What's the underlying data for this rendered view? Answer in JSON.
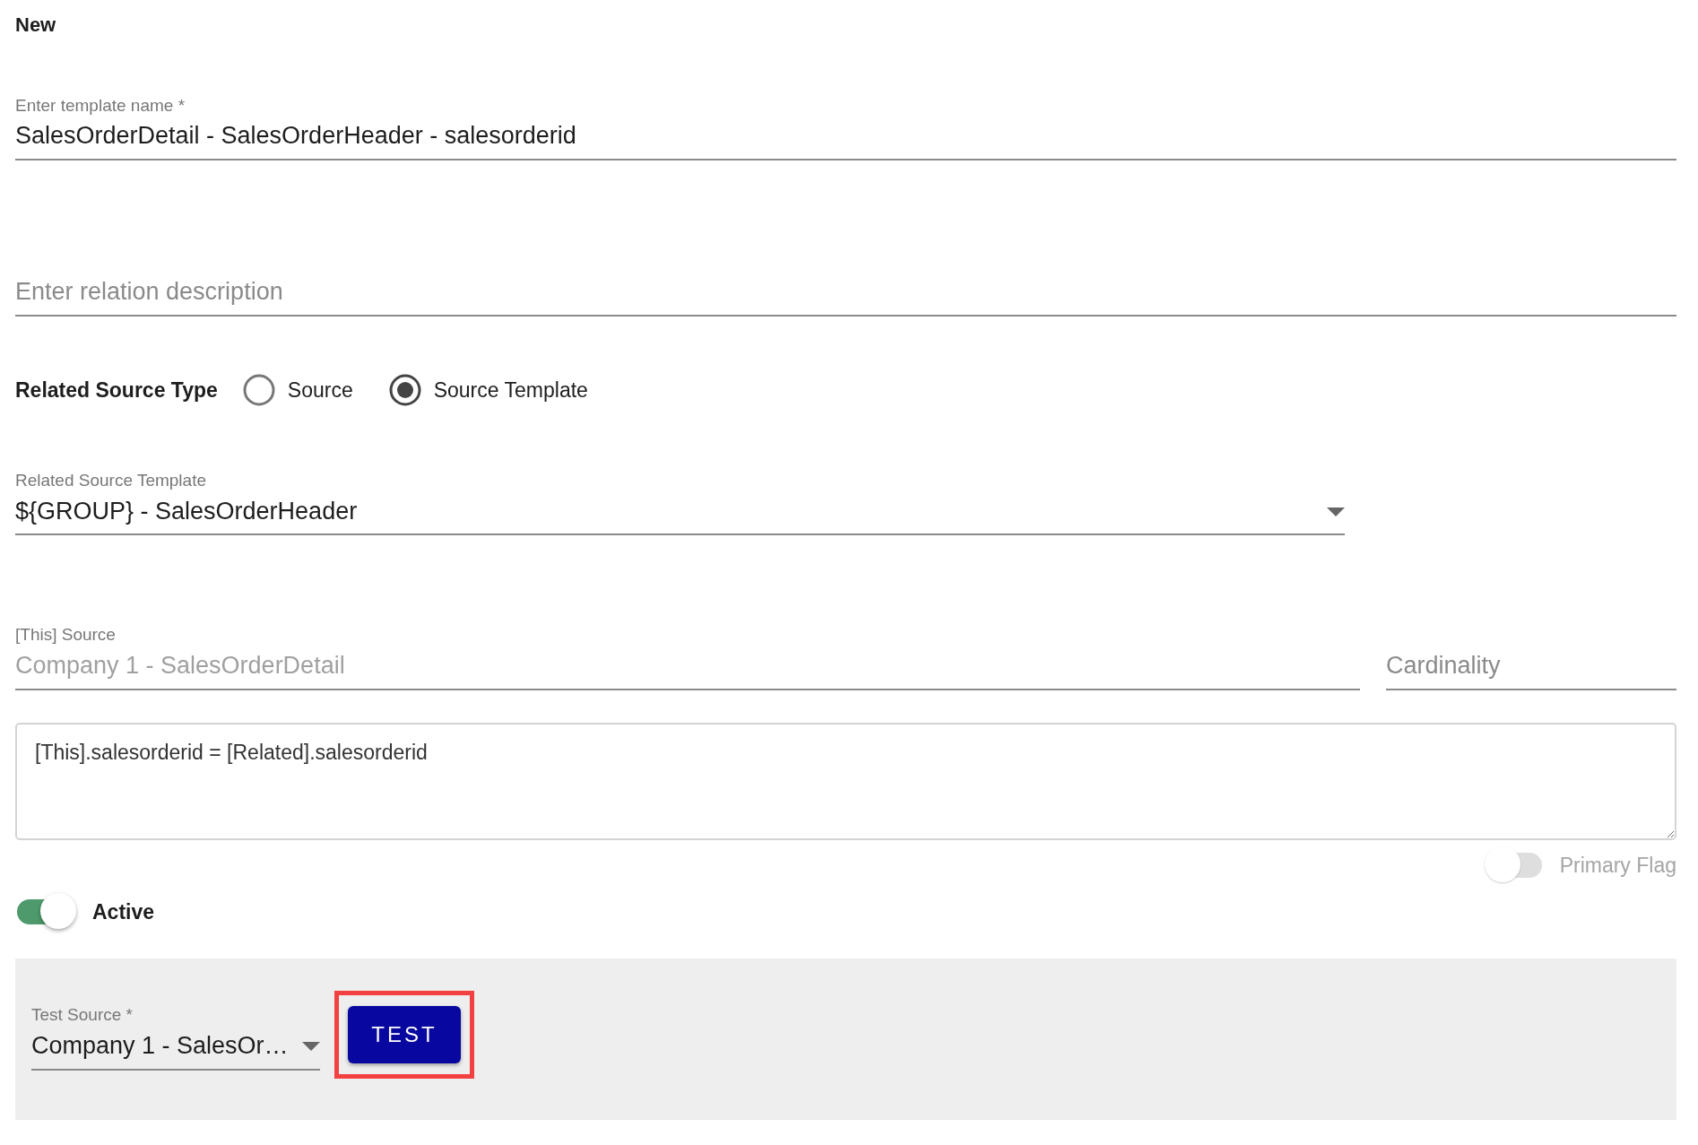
{
  "title": "New",
  "template_name": {
    "label": "Enter template name *",
    "value": "SalesOrderDetail - SalesOrderHeader - salesorderid"
  },
  "description": {
    "placeholder": "Enter relation description"
  },
  "related_source_type": {
    "label": "Related Source Type",
    "options": [
      {
        "label": "Source",
        "selected": false
      },
      {
        "label": "Source Template",
        "selected": true
      }
    ]
  },
  "related_source_template": {
    "label": "Related Source Template",
    "value": "${GROUP} - SalesOrderHeader"
  },
  "this_source": {
    "label": "[This] Source",
    "value": "Company 1 - SalesOrderDetail",
    "disabled": true
  },
  "cardinality": {
    "placeholder": "Cardinality"
  },
  "condition": {
    "value": "[This].salesorderid = [Related].salesorderid"
  },
  "primary_flag": {
    "label": "Primary Flag",
    "on": false,
    "disabled": true
  },
  "active": {
    "label": "Active",
    "on": true,
    "disabled": false
  },
  "test_panel": {
    "test_source": {
      "label": "Test Source *",
      "value": "Company 1 - SalesOr…"
    },
    "test_button": {
      "label": "TEST",
      "highlighted": true
    }
  }
}
